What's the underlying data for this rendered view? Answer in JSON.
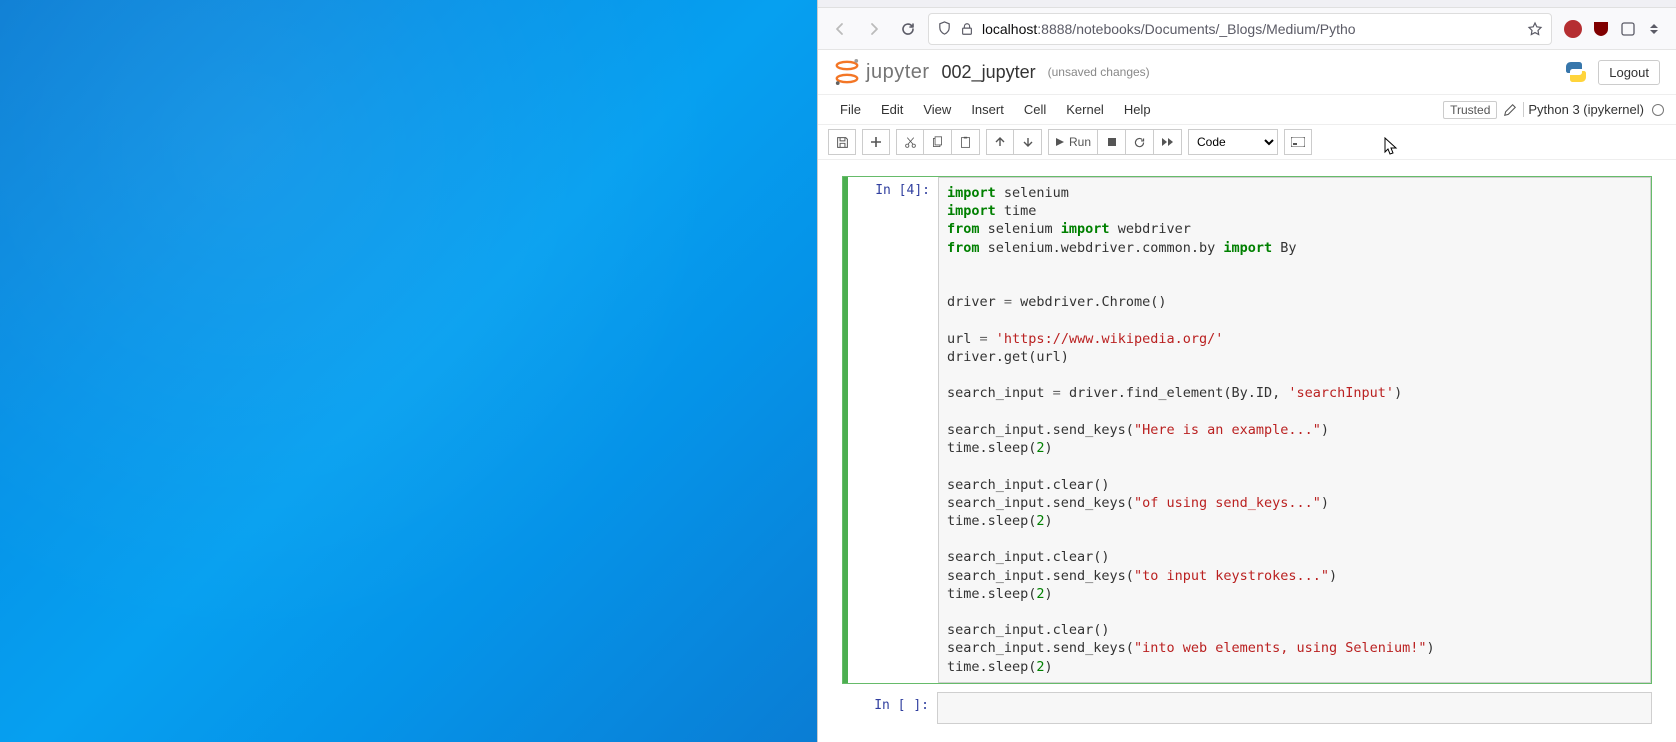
{
  "browser": {
    "url_prefix": "localhost",
    "url_port_path": ":8888/notebooks/Documents/_Blogs/Medium/Pytho"
  },
  "header": {
    "brand": "jupyter",
    "notebook_name": "002_jupyter",
    "unsaved": "(unsaved changes)",
    "logout": "Logout"
  },
  "menu": {
    "items": [
      "File",
      "Edit",
      "View",
      "Insert",
      "Cell",
      "Kernel",
      "Help"
    ],
    "trusted": "Trusted",
    "kernel": "Python 3 (ipykernel)"
  },
  "toolbar": {
    "run_label": "Run",
    "celltype": "Code"
  },
  "cells": [
    {
      "prompt": "In [4]:",
      "selected": true,
      "code": "import selenium\nimport time\nfrom selenium import webdriver\nfrom selenium.webdriver.common.by import By\n\n\ndriver = webdriver.Chrome()\n\nurl = 'https://www.wikipedia.org/'\ndriver.get(url)\n\nsearch_input = driver.find_element(By.ID, 'searchInput')\n\nsearch_input.send_keys(\"Here is an example...\")\ntime.sleep(2)\n\nsearch_input.clear()\nsearch_input.send_keys(\"of using send_keys...\")\ntime.sleep(2)\n\nsearch_input.clear()\nsearch_input.send_keys(\"to input keystrokes...\")\ntime.sleep(2)\n\nsearch_input.clear()\nsearch_input.send_keys(\"into web elements, using Selenium!\")\ntime.sleep(2)"
    },
    {
      "prompt": "In [ ]:",
      "selected": false,
      "code": ""
    }
  ]
}
